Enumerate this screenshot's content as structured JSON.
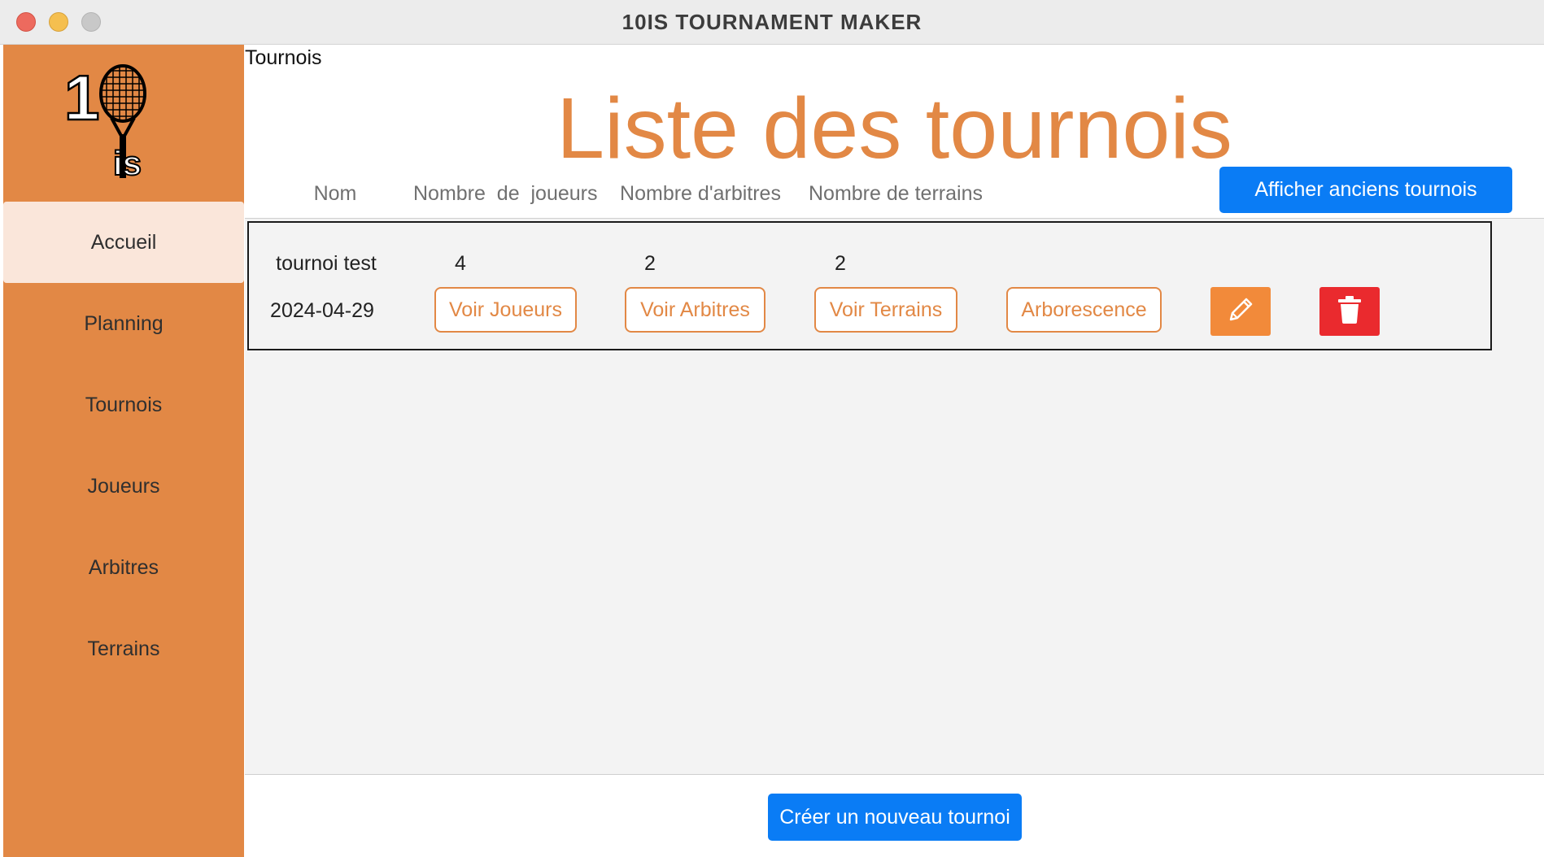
{
  "window": {
    "title": "10IS TOURNAMENT MAKER"
  },
  "sidebar": {
    "logo_text": "10is",
    "items": [
      {
        "label": "Accueil",
        "active": true
      },
      {
        "label": "Planning",
        "active": false
      },
      {
        "label": "Tournois",
        "active": false
      },
      {
        "label": "Joueurs",
        "active": false
      },
      {
        "label": "Arbitres",
        "active": false
      },
      {
        "label": "Terrains",
        "active": false
      }
    ]
  },
  "main": {
    "breadcrumb": "Tournois",
    "title": "Liste des tournois",
    "columns": {
      "nom": "Nom",
      "joueurs": "Nombre  de  joueurs",
      "arbitres": "Nombre d'arbitres",
      "terrains": "Nombre de terrains"
    },
    "archive_button": "Afficher anciens tournois",
    "tournaments": [
      {
        "name": "tournoi test",
        "date": "2024-04-29",
        "players": "4",
        "referees": "2",
        "courts": "2",
        "btn_players": "Voir Joueurs",
        "btn_referees": "Voir Arbitres",
        "btn_courts": "Voir Terrains",
        "btn_tree": "Arborescence",
        "edit_icon": "pencil-icon",
        "delete_icon": "trash-icon"
      }
    ],
    "create_button": "Créer un nouveau tournoi"
  },
  "colors": {
    "accent_orange": "#e28845",
    "primary_blue": "#0a7cf5",
    "danger_red": "#ea2a2e",
    "active_nav_bg": "#fae6da"
  }
}
